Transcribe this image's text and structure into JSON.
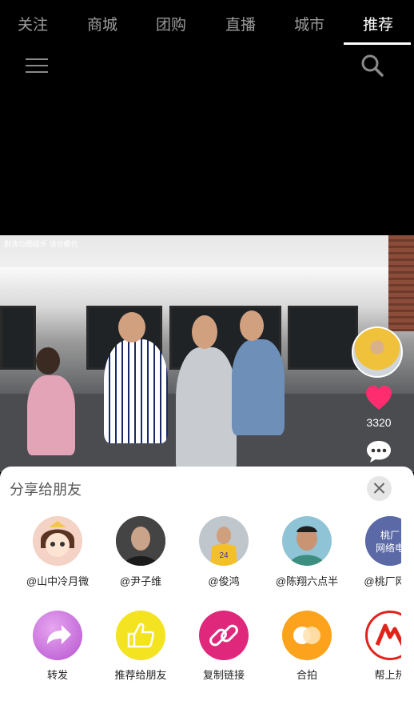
{
  "nav": {
    "tabs": [
      {
        "label": "关注",
        "active": false
      },
      {
        "label": "商城",
        "active": false
      },
      {
        "label": "团购",
        "active": false
      },
      {
        "label": "直播",
        "active": false
      },
      {
        "label": "城市",
        "active": false
      },
      {
        "label": "推荐",
        "active": true
      }
    ],
    "menu_icon": "hamburger-icon",
    "search_icon": "search-icon"
  },
  "video": {
    "watermark": "剧清均图娱乐 请勿模仿",
    "likes": "3320"
  },
  "share_sheet": {
    "title": "分享给朋友",
    "friends": [
      {
        "name": "@山中冷月微"
      },
      {
        "name": "@尹子维"
      },
      {
        "name": "@俊鸿"
      },
      {
        "name": "@陈翔六点半"
      },
      {
        "name": "@桃厂网络"
      }
    ],
    "actions": [
      {
        "label": "转发",
        "icon": "forward-icon"
      },
      {
        "label": "推荐给朋友",
        "icon": "thumbs-up-icon"
      },
      {
        "label": "复制链接",
        "icon": "link-icon"
      },
      {
        "label": "合拍",
        "icon": "duet-icon"
      },
      {
        "label": "帮上热",
        "icon": "hot-boost-icon"
      }
    ]
  },
  "colors": {
    "heart": "#ff2d6f",
    "forward": "#c46ad6",
    "recommend": "#f2e21f",
    "copy_link": "#e0287a",
    "duet": "#fba11d",
    "hot": "#e0241b"
  }
}
